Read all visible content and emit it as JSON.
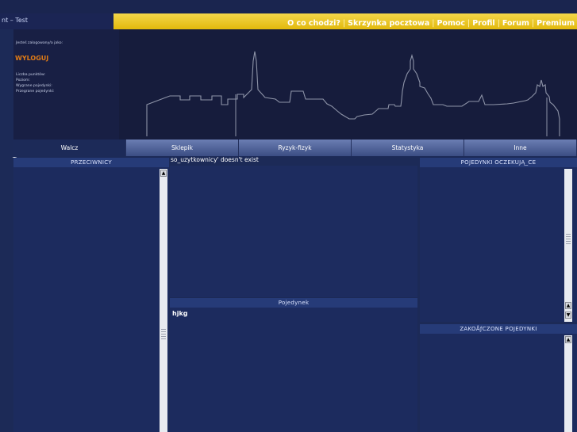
{
  "window": {
    "title": "nt – Test"
  },
  "nav": {
    "links": [
      "O co chodzi?",
      "Skrzynka pocztowa",
      "Pomoc",
      "Profil",
      "Forum",
      "Premium"
    ]
  },
  "login": {
    "logged_as": "Jesteś zalogowany/a jako:",
    "logout": "WYLOGUJ",
    "stats": [
      "Liczba punktów:",
      "Poziom:",
      "Wygrane pojedynki:",
      "Przegrane pojedynki:"
    ]
  },
  "tabs": [
    "Walcz",
    "Sklepik",
    "Ryzyk-fizyk",
    "Statystyka",
    "Inne"
  ],
  "active_tab": "Walcz",
  "error_fragment": "T",
  "error": "so_uzytkownicy' doesn't exist",
  "panels": {
    "opponents": "PRZECIWNICY",
    "duel": "Pojedynek",
    "duel_log": "hjkg",
    "pending": "POJEDYNKI OCZEKUJĄ_CE",
    "finished": "ZAKOÅƒCZONE POJEDYNKI"
  },
  "colors": {
    "accent": "#f0cc2e",
    "logout": "#e07b16",
    "panel": "#1c2b5e",
    "header": "#263b78"
  }
}
